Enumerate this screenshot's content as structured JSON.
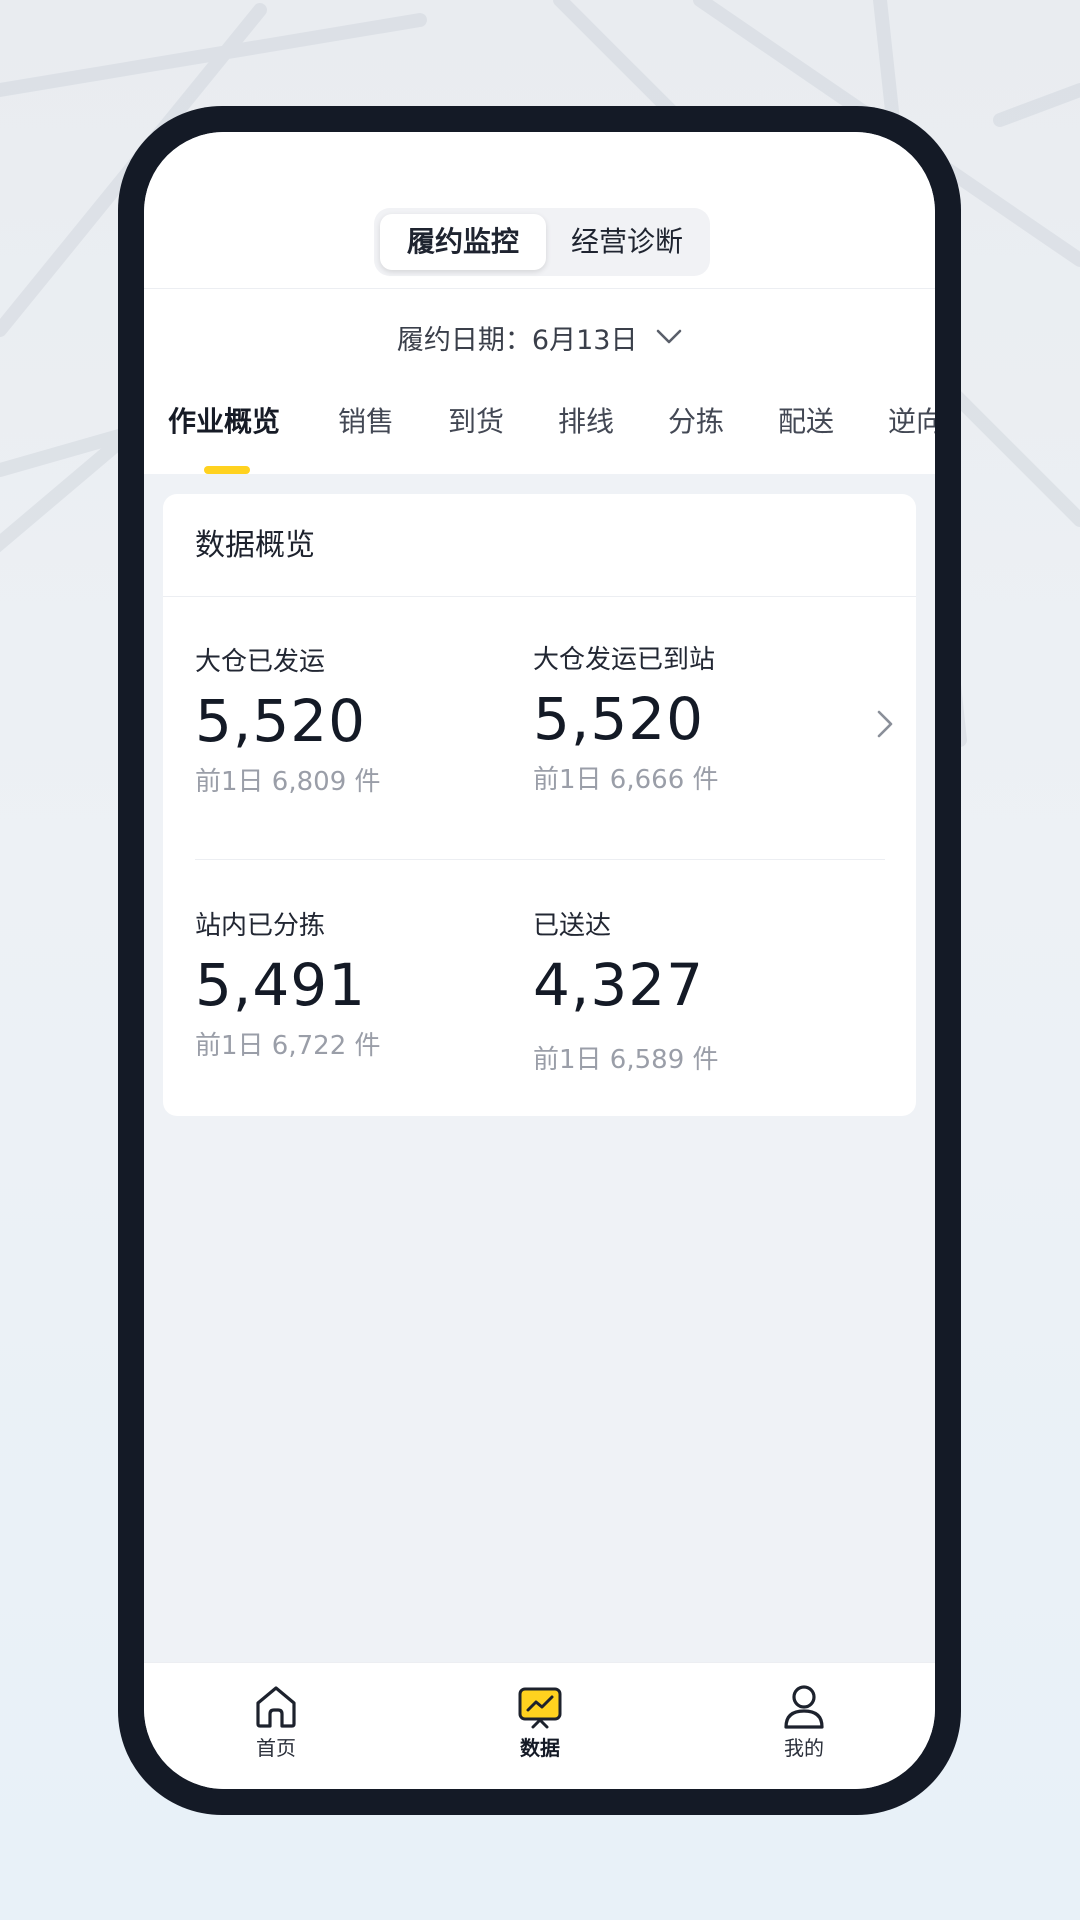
{
  "segment": {
    "active_label": "履约监控",
    "inactive_label": "经营诊断"
  },
  "date": {
    "text": "履约日期：6月13日"
  },
  "tabs": [
    {
      "label": "作业概览",
      "active": true
    },
    {
      "label": "销售"
    },
    {
      "label": "到货"
    },
    {
      "label": "排线"
    },
    {
      "label": "分拣"
    },
    {
      "label": "配送"
    },
    {
      "label": "逆向"
    }
  ],
  "overview": {
    "title": "数据概览",
    "metrics": [
      {
        "label": "大仓已发运",
        "value": "5,520",
        "prev": "前1日  6,809 件"
      },
      {
        "label": "大仓发运已到站",
        "value": "5,520",
        "prev": "前1日  6,666 件"
      },
      {
        "label": "站内已分拣",
        "value": "5,491",
        "prev": "前1日  6,722 件"
      },
      {
        "label": "已送达",
        "value": "4,327",
        "prev": "前1日  6,589 件"
      }
    ]
  },
  "nav": [
    {
      "label": "首页",
      "icon": "home-icon"
    },
    {
      "label": "数据",
      "icon": "chart-icon",
      "active": true
    },
    {
      "label": "我的",
      "icon": "user-icon"
    }
  ],
  "colors": {
    "accent": "#ffd21f",
    "phone_frame": "#141a26",
    "text_primary": "#141a26",
    "text_secondary": "#9a9ea8"
  }
}
